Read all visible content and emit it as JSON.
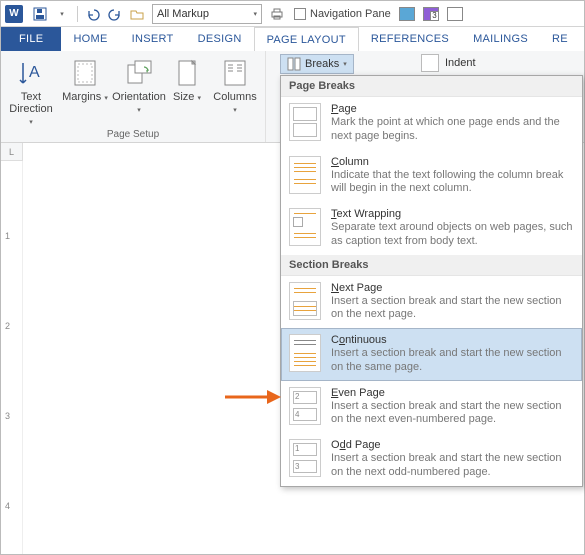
{
  "qat": {
    "markup": "All Markup",
    "navpane": "Navigation Pane"
  },
  "tabs": [
    "FILE",
    "HOME",
    "INSERT",
    "DESIGN",
    "PAGE LAYOUT",
    "REFERENCES",
    "MAILINGS",
    "RE"
  ],
  "ribbon": {
    "group_pagesetup_label": "Page Setup",
    "btn_textdir": "Text Direction",
    "btn_margins": "Margins",
    "btn_orient": "Orientation",
    "btn_size": "Size",
    "btn_cols": "Columns",
    "breaks": "Breaks",
    "indent": "Indent"
  },
  "ruler_marks": [
    "1",
    "2",
    "3",
    "4"
  ],
  "menu": {
    "hdr_page": "Page Breaks",
    "hdr_section": "Section Breaks",
    "items": [
      {
        "title": "Page",
        "key": "P",
        "desc": "Mark the point at which one page ends and the next page begins."
      },
      {
        "title": "Column",
        "key": "C",
        "desc": "Indicate that the text following the column break will begin in the next column."
      },
      {
        "title": "Text Wrapping",
        "key": "T",
        "desc": "Separate text around objects on web pages, such as caption text from body text."
      },
      {
        "title": "Next Page",
        "key": "N",
        "desc": "Insert a section break and start the new section on the next page."
      },
      {
        "title": "Continuous",
        "key": "O",
        "desc": "Insert a section break and start the new section on the same page."
      },
      {
        "title": "Even Page",
        "key": "E",
        "desc": "Insert a section break and start the new section on the next even-numbered page."
      },
      {
        "title": "Odd Page",
        "key": "D",
        "desc": "Insert a section break and start the new section on the next odd-numbered page."
      }
    ]
  }
}
